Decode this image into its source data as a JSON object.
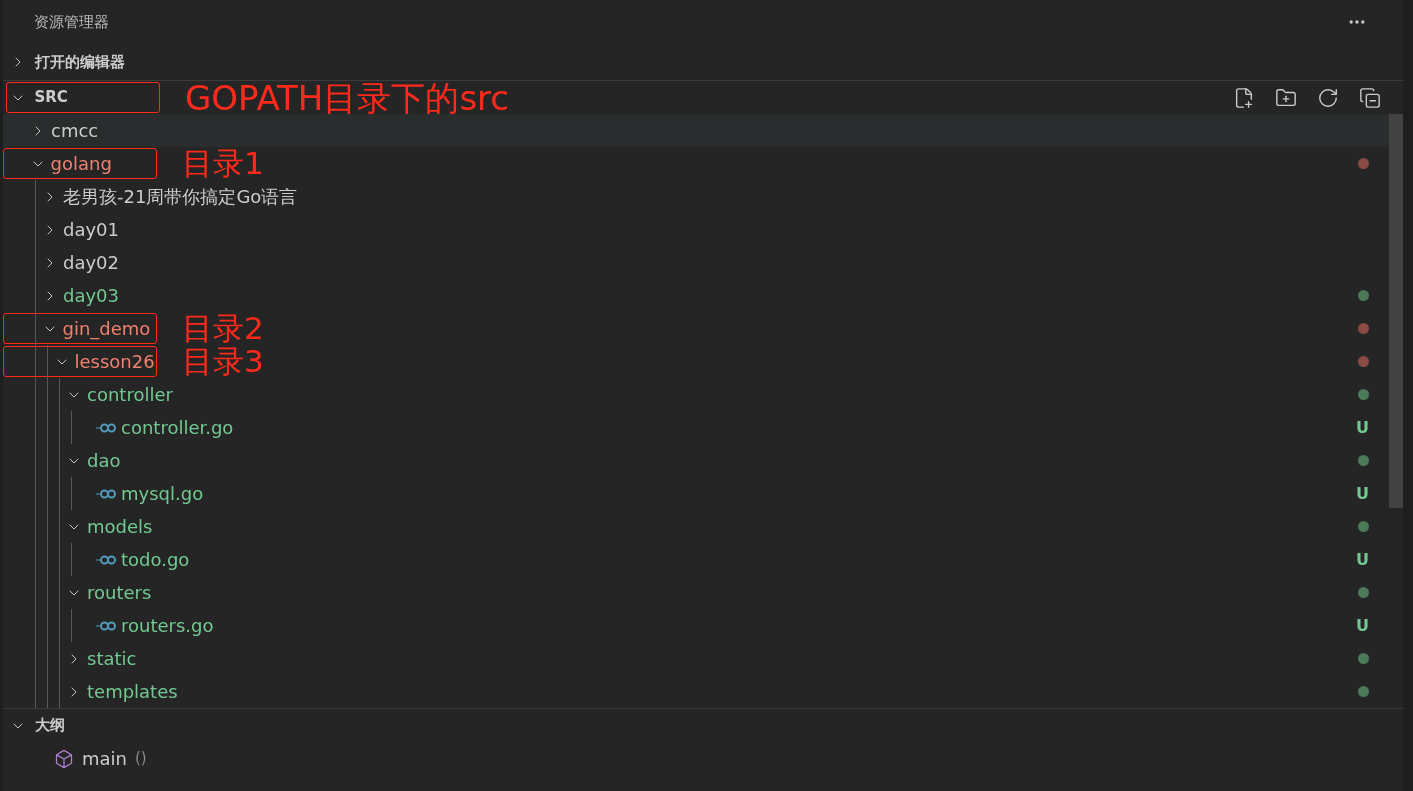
{
  "panel": {
    "title": "资源管理器"
  },
  "open_editors": {
    "title": "打开的编辑器",
    "expanded": false
  },
  "workspace": {
    "title": "SRC",
    "expanded": true,
    "annotation": "GOPATH目录下的src",
    "tree": [
      {
        "name": "cmcc",
        "kind": "folder",
        "expanded": false,
        "modified": false,
        "untracked": false,
        "highlighted": true
      },
      {
        "name": "golang",
        "kind": "folder",
        "expanded": true,
        "modified": true,
        "highlighted": false,
        "annotation": "目录1",
        "children": [
          {
            "name": "老男孩-21周带你搞定Go语言",
            "kind": "folder",
            "expanded": false,
            "modified": false,
            "untracked": false,
            "highlighted": false
          },
          {
            "name": "day01",
            "kind": "folder",
            "expanded": false,
            "modified": false,
            "untracked": false,
            "highlighted": false
          },
          {
            "name": "day02",
            "kind": "folder",
            "expanded": false,
            "modified": false,
            "untracked": false,
            "highlighted": false
          },
          {
            "name": "day03",
            "kind": "folder",
            "expanded": false,
            "modified": false,
            "untracked": true,
            "highlighted": false
          },
          {
            "name": "gin_demo",
            "kind": "folder",
            "expanded": true,
            "modified": true,
            "highlighted": false,
            "annotation": "目录2",
            "children": [
              {
                "name": "lesson26",
                "kind": "folder",
                "expanded": true,
                "modified": true,
                "highlighted": false,
                "annotation": "目录3",
                "children": [
                  {
                    "name": "controller",
                    "kind": "folder",
                    "expanded": true,
                    "modified": false,
                    "untracked": true,
                    "highlighted": false,
                    "children": [
                      {
                        "name": "controller.go",
                        "kind": "file",
                        "modified": false,
                        "untracked": true,
                        "badge": "U",
                        "highlighted": false
                      }
                    ]
                  },
                  {
                    "name": "dao",
                    "kind": "folder",
                    "expanded": true,
                    "modified": false,
                    "untracked": true,
                    "highlighted": false,
                    "children": [
                      {
                        "name": "mysql.go",
                        "kind": "file",
                        "modified": false,
                        "untracked": true,
                        "badge": "U",
                        "highlighted": false
                      }
                    ]
                  },
                  {
                    "name": "models",
                    "kind": "folder",
                    "expanded": true,
                    "modified": false,
                    "untracked": true,
                    "highlighted": false,
                    "children": [
                      {
                        "name": "todo.go",
                        "kind": "file",
                        "modified": false,
                        "untracked": true,
                        "badge": "U",
                        "highlighted": false
                      }
                    ]
                  },
                  {
                    "name": "routers",
                    "kind": "folder",
                    "expanded": true,
                    "modified": false,
                    "untracked": true,
                    "highlighted": false,
                    "children": [
                      {
                        "name": "routers.go",
                        "kind": "file",
                        "modified": false,
                        "untracked": true,
                        "badge": "U",
                        "highlighted": false
                      }
                    ]
                  },
                  {
                    "name": "static",
                    "kind": "folder",
                    "expanded": false,
                    "modified": false,
                    "untracked": true,
                    "highlighted": false
                  },
                  {
                    "name": "templates",
                    "kind": "folder",
                    "expanded": false,
                    "modified": false,
                    "untracked": true,
                    "highlighted": false
                  }
                ]
              }
            ]
          }
        ]
      }
    ]
  },
  "outline": {
    "title": "大纲",
    "expanded": true,
    "items": [
      {
        "name": "main",
        "detail": "()"
      }
    ]
  }
}
